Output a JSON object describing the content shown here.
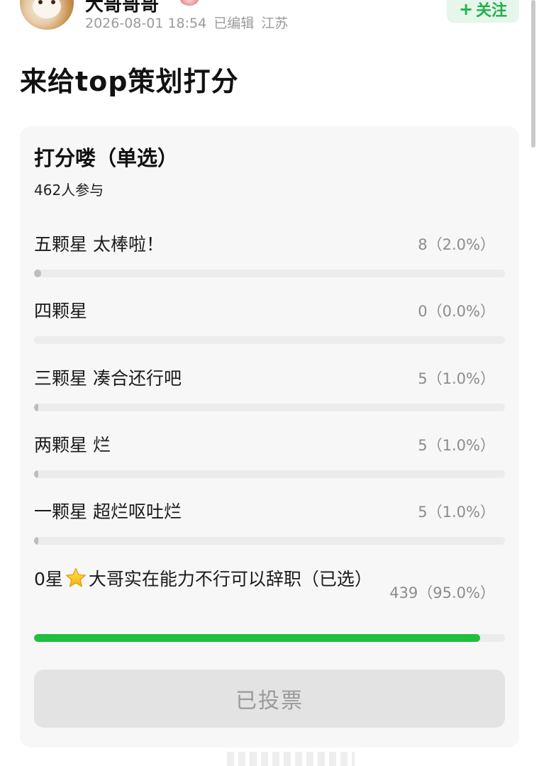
{
  "header": {
    "username": "大哥哥哥",
    "meta": {
      "datetime": "2026-08-01 18:54",
      "edited": "已编辑",
      "location": "江苏"
    },
    "follow": {
      "plus": "+",
      "label": "关注"
    }
  },
  "post": {
    "title": "来给top策划打分"
  },
  "poll": {
    "title": "打分喽（单选）",
    "participants": "462人参与",
    "options": [
      {
        "label": "五颗星 太棒啦！",
        "count": "8（2.0%）",
        "percent": 2.0,
        "selected": false
      },
      {
        "label": "四颗星",
        "count": "0（0.0%）",
        "percent": 0.0,
        "selected": false
      },
      {
        "label": "三颗星 凑合还行吧",
        "count": "5（1.0%）",
        "percent": 1.0,
        "selected": false
      },
      {
        "label": "两颗星 烂",
        "count": "5（1.0%）",
        "percent": 1.0,
        "selected": false
      },
      {
        "label": "一颗星 超烂呕吐烂",
        "count": "5（1.0%）",
        "percent": 1.0,
        "selected": false
      },
      {
        "label_prefix": "0星",
        "label_rest": "大哥实在能力不行可以辞职（已选）",
        "count": "439（95.0%）",
        "percent": 95.0,
        "selected": true
      }
    ],
    "voted_label": "已投票"
  },
  "colors": {
    "accent_green": "#1fbf3f",
    "follow_bg": "#e6f6ea",
    "follow_text": "#1eb24a",
    "bar_unselected": "#bdbdbd",
    "card_bg": "#f7f7f7"
  },
  "icons": {
    "star": "star-emoji-icon",
    "avatar": "cat-avatar",
    "badge": "user-badge-icon"
  }
}
